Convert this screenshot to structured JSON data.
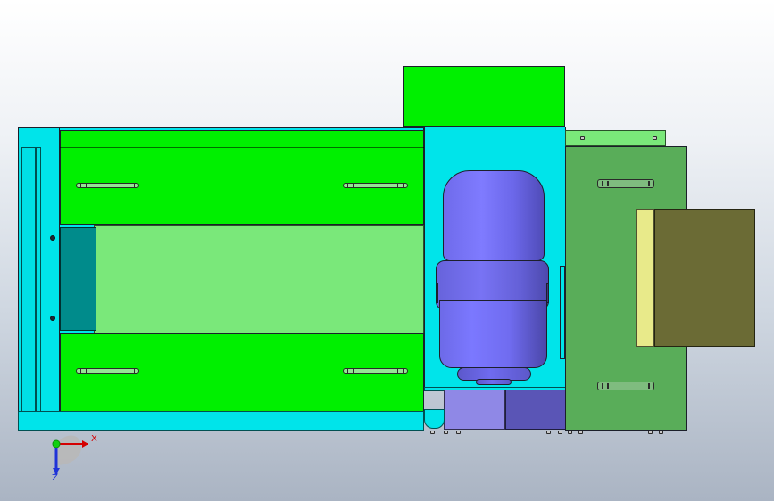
{
  "axis_triad": {
    "x_label": "X",
    "y_label": "Z",
    "x_color": "#d40000",
    "z_color": "#1f33d8",
    "origin_color": "#10d010"
  },
  "palette": {
    "background_top": "#ffffff",
    "background_bottom": "#aab4c3",
    "cyan": "#00e4ea",
    "bright_green": "#00f000",
    "light_green": "#7ae87a",
    "teal": "#008b8b",
    "dark_green": "#59ad59",
    "olive": "#6b6b35",
    "yellow": "#e8ea8a",
    "motor_blue": "#7b78ff",
    "gearbox_purple": "#5a55b6"
  },
  "icons": {
    "hole": "circle-hole",
    "fastener": "bolt-head",
    "slot": "long-slot"
  }
}
